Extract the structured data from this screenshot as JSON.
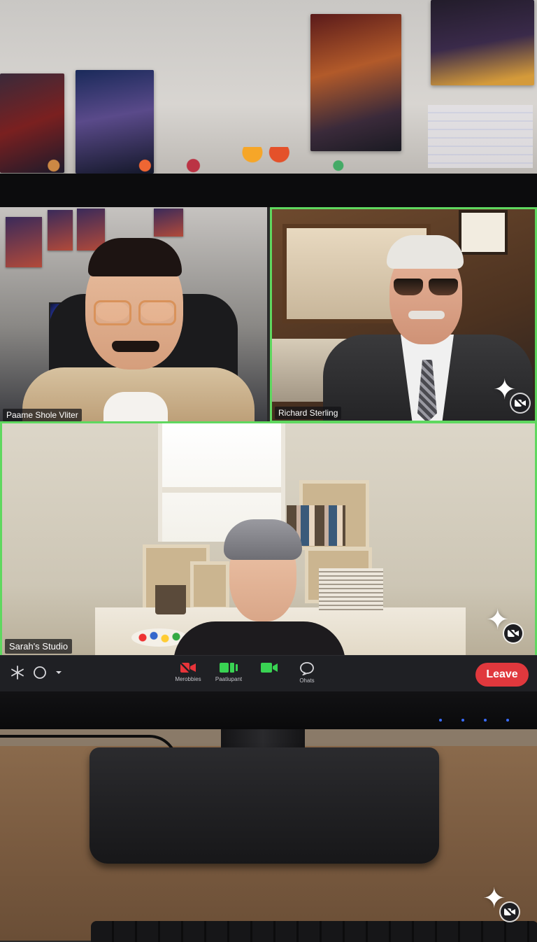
{
  "participants": [
    {
      "name": "Paame Shole Vliter"
    },
    {
      "name": "Richard Sterling"
    },
    {
      "name": "Sarah's Studio"
    }
  ],
  "toolbar": {
    "buttons": [
      {
        "label": "Merobbies",
        "icon": "camera-off-icon",
        "color": "#e8343a"
      },
      {
        "label": "Paatiupant",
        "icon": "participants-icon",
        "color": "#39d353"
      },
      {
        "label": "",
        "icon": "video-camera-icon",
        "color": "#39d353"
      },
      {
        "label": "Ohats",
        "icon": "chat-icon",
        "color": "#d8d8dc"
      }
    ],
    "leave_label": "Leave",
    "leave_color": "#e0383d"
  },
  "highlight_color": "#5fd85f",
  "watermark_icon": "sparkle-icon"
}
